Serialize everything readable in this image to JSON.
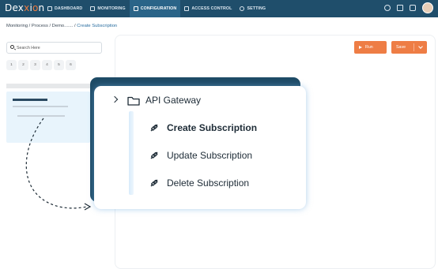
{
  "app": {
    "logo_text": "Dexxion"
  },
  "nav": {
    "items": [
      {
        "label": "DASHBOARD",
        "icon": "dashboard-icon"
      },
      {
        "label": "MONITORING",
        "icon": "monitor-icon"
      },
      {
        "label": "CONFIGURATION",
        "icon": "sliders-icon",
        "active": true
      },
      {
        "label": "ACCESS CONTROL",
        "icon": "lock-icon"
      },
      {
        "label": "SETTING",
        "icon": "gear-icon"
      }
    ]
  },
  "breadcrumb": {
    "path": "Monitoring / Process / Demo....... / ",
    "current": "Create Subscription"
  },
  "search": {
    "placeholder": "Search Here"
  },
  "pagination": [
    "1",
    "2",
    "3",
    "4",
    "5",
    "6"
  ],
  "toolbar": {
    "run_label": "Run",
    "save_label": "Save"
  },
  "popup": {
    "group_label": "API Gateway",
    "items": [
      {
        "label": "Create Subscription",
        "icon": "link-icon",
        "active": true
      },
      {
        "label": "Update Subscription",
        "icon": "link-icon"
      },
      {
        "label": "Delete Subscription",
        "icon": "link-icon"
      }
    ]
  },
  "colors": {
    "nav_bg": "#1f4e6b",
    "accent": "#ee7d45",
    "panel_dark": "#1e4b66",
    "highlight": "#e8f4fc"
  }
}
